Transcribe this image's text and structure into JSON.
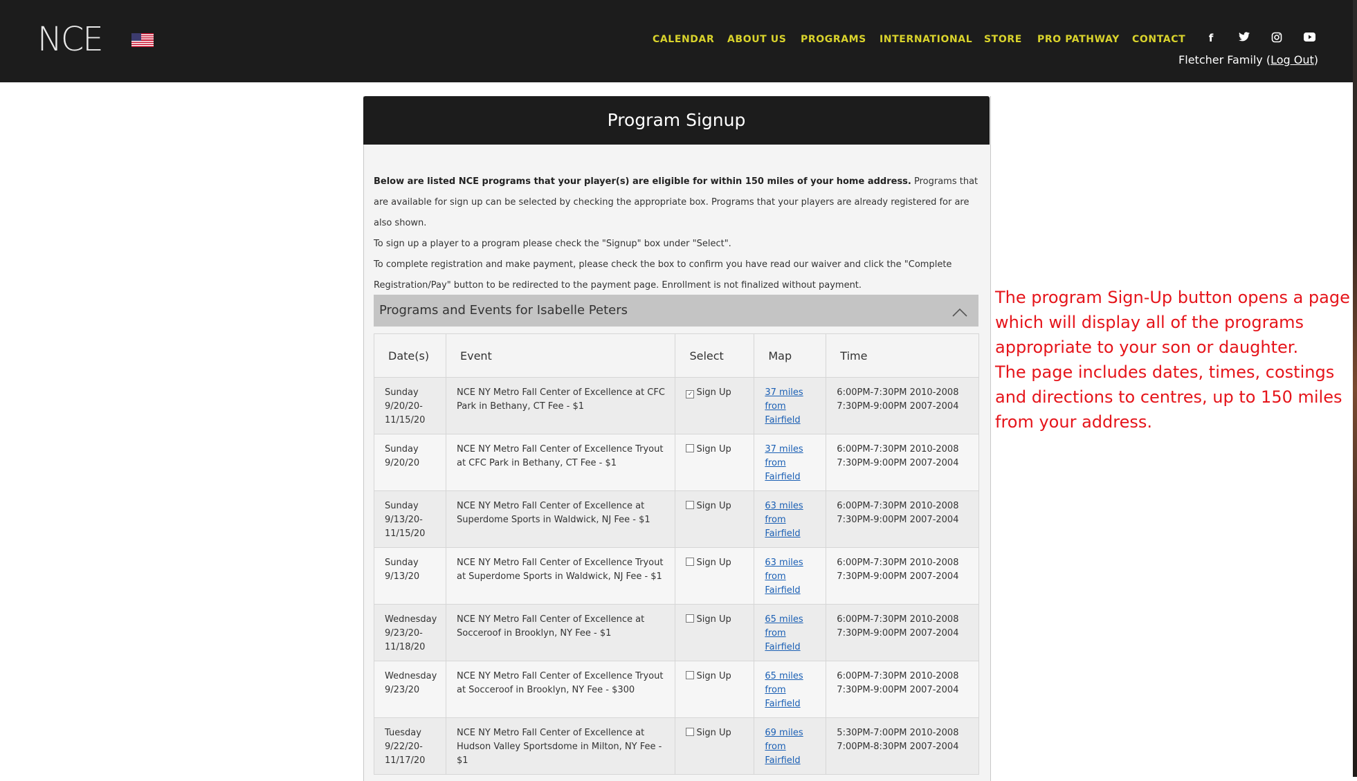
{
  "header": {
    "logo": "NCE",
    "flag_label": "US",
    "nav": [
      "CALENDAR",
      "ABOUT US",
      "PROGRAMS",
      "INTERNATIONAL",
      "STORE",
      "PRO PATHWAY",
      "CONTACT"
    ],
    "social": [
      "facebook-icon",
      "twitter-icon",
      "instagram-icon",
      "youtube-icon"
    ],
    "user_name": "Fletcher Family",
    "logout_label": "Log Out"
  },
  "panel": {
    "title": "Program Signup",
    "intro": {
      "lead_bold": "Below are listed NCE programs that your player(s) are eligible for within 150 miles of your home address.",
      "lead_rest": " Programs that are available for sign up can be selected by checking the appropriate box. Programs that your players are already registered for are also shown.",
      "line2": "To sign up a player to a program please check the \"Signup\" box under \"Select\".",
      "line3": "To complete registration and make payment, please check the box to confirm you have read our waiver and click the \"Complete Registration/Pay\" button to be redirected to the payment page. Enrollment is not finalized without payment."
    },
    "section_title": "Programs and Events for Isabelle Peters",
    "table": {
      "headers": [
        "Date(s)",
        "Event",
        "Select",
        "Map",
        "Time"
      ],
      "signup_label": "Sign Up",
      "rows": [
        {
          "day": "Sunday",
          "date1": "9/20/20-",
          "date2": "11/15/20",
          "event": "NCE NY Metro Fall Center of Excellence at CFC Park in Bethany, CT Fee - $1",
          "checked": true,
          "map1": "37 miles",
          "map2": "from",
          "map3": "Fairfield",
          "time1": "6:00PM-7:30PM 2010-2008",
          "time2": "7:30PM-9:00PM 2007-2004"
        },
        {
          "day": "Sunday",
          "date1": "9/20/20",
          "date2": "",
          "event": "NCE NY Metro Fall Center of Excellence Tryout at CFC Park in Bethany, CT Fee - $1",
          "checked": false,
          "map1": "37 miles",
          "map2": "from",
          "map3": "Fairfield",
          "time1": "6:00PM-7:30PM 2010-2008",
          "time2": "7:30PM-9:00PM 2007-2004"
        },
        {
          "day": "Sunday",
          "date1": "9/13/20-",
          "date2": "11/15/20",
          "event": "NCE NY Metro Fall Center of Excellence at Superdome Sports in Waldwick, NJ Fee - $1",
          "checked": false,
          "map1": "63 miles",
          "map2": "from",
          "map3": "Fairfield",
          "time1": "6:00PM-7:30PM 2010-2008",
          "time2": "7:30PM-9:00PM 2007-2004"
        },
        {
          "day": "Sunday",
          "date1": "9/13/20",
          "date2": "",
          "event": "NCE NY Metro Fall Center of Excellence Tryout at Superdome Sports in Waldwick, NJ Fee - $1",
          "checked": false,
          "map1": "63 miles",
          "map2": "from",
          "map3": "Fairfield",
          "time1": "6:00PM-7:30PM 2010-2008",
          "time2": "7:30PM-9:00PM 2007-2004"
        },
        {
          "day": "Wednesday",
          "date1": "9/23/20-",
          "date2": "11/18/20",
          "event": "NCE NY Metro Fall Center of Excellence at Socceroof in Brooklyn, NY Fee - $1",
          "checked": false,
          "map1": "65 miles",
          "map2": "from",
          "map3": "Fairfield",
          "time1": "6:00PM-7:30PM 2010-2008",
          "time2": "7:30PM-9:00PM 2007-2004"
        },
        {
          "day": "Wednesday",
          "date1": "9/23/20",
          "date2": "",
          "event": "NCE NY Metro Fall Center of Excellence Tryout at Socceroof in Brooklyn, NY Fee - $300",
          "checked": false,
          "map1": "65 miles",
          "map2": "from",
          "map3": "Fairfield",
          "time1": "6:00PM-7:30PM 2010-2008",
          "time2": "7:30PM-9:00PM 2007-2004"
        },
        {
          "day": "Tuesday",
          "date1": "9/22/20-",
          "date2": "11/17/20",
          "event": "NCE NY Metro Fall Center of Excellence at Hudson Valley Sportsdome in Milton, NY Fee - $1",
          "checked": false,
          "map1": "69 miles",
          "map2": "from",
          "map3": "Fairfield",
          "time1": "5:30PM-7:00PM 2010-2008",
          "time2": "7:00PM-8:30PM 2007-2004"
        }
      ]
    }
  },
  "annotation": {
    "lines": [
      "The program Sign-Up button opens a page",
      "which will display all of the programs",
      "appropriate to your son or daughter.",
      "The page includes dates, times, costings",
      "and directions to centres, up to 150 miles",
      "from your address."
    ]
  },
  "colors": {
    "header_bg": "#1c1c1c",
    "nav_text": "#d9d32c",
    "annotation_text": "#e5141a",
    "link": "#1a5fb4"
  }
}
